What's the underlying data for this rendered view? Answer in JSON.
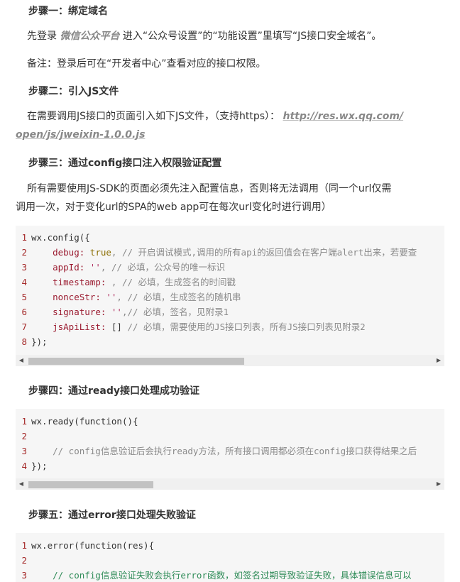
{
  "steps": [
    {
      "heading": "步骤一：绑定域名"
    },
    {
      "heading": "步骤二：引入JS文件"
    },
    {
      "heading": "步骤三：通过config接口注入权限验证配置"
    },
    {
      "heading": "步骤四：通过ready接口处理成功验证"
    },
    {
      "heading": "步骤五：通过error接口处理失败验证"
    }
  ],
  "step1": {
    "text_before": "先登录",
    "brand": "微信公众平台",
    "text_after": " 进入“公众号设置”的“功能设置”里填写“JS接口安全域名”。",
    "note": "备注：登录后可在“开发者中心”查看对应的接口权限。"
  },
  "step2": {
    "text": "在需要调用JS接口的页面引入如下JS文件，（支持https）：",
    "link_part1": "http://res.wx.qq.com/",
    "link_part2": "open/js/jweixin-1.0.0.js"
  },
  "step3": {
    "line1": "所有需要使用JS-SDK的页面必须先注入配置信息，否则将无法调用（同一个url仅需",
    "line2": "调用一次，对于变化url的SPA的web app可在每次url变化时进行调用）"
  },
  "code_config": {
    "ln": [
      "1",
      "2",
      "3",
      "4",
      "5",
      "6",
      "7",
      "8"
    ],
    "l1": "wx.config({",
    "l2_key": "debug:",
    "l2_val": " true",
    "l2_cm": ", // 开启调试模式,调用的所有api的返回值会在客户端alert出来，若要查",
    "l3_key": "appId:",
    "l3_val": " ''",
    "l3_cm": ", // 必填，公众号的唯一标识",
    "l4_key": "timestamp:",
    "l4_cm": " , // 必填，生成签名的时间戳",
    "l5_key": "nonceStr:",
    "l5_val": " ''",
    "l5_cm": ", // 必填，生成签名的随机串",
    "l6_key": "signature:",
    "l6_val": " ''",
    "l6_cm": ",// 必填，签名，见附录1",
    "l7_key": "jsApiList:",
    "l7_val": " []",
    "l7_cm": " // 必填，需要使用的JS接口列表，所有JS接口列表见附录2",
    "l8": "});"
  },
  "code_ready": {
    "ln": [
      "1",
      "2",
      "3",
      "4"
    ],
    "l1_a": "wx.ready(",
    "l1_fn": "function",
    "l1_b": "(){",
    "l3": "    // config信息验证后会执行ready方法，所有接口调用都必须在config接口获得结果之后",
    "l4": "});"
  },
  "code_error": {
    "ln": [
      "1",
      "2",
      "3"
    ],
    "l1_a": "wx.error(",
    "l1_fn": "function",
    "l1_b": "(res){",
    "l3": "    // config信息验证失败会执行error函数，如签名过期导致验证失败，具体错误信息可以"
  },
  "scrollbar": {
    "left_arrow": "◀",
    "right_arrow": "▶"
  }
}
